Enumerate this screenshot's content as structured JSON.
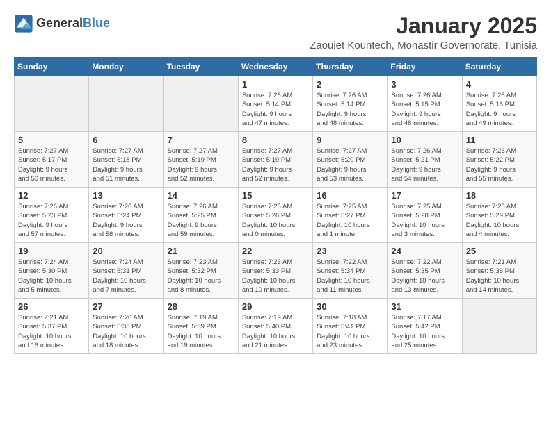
{
  "header": {
    "logo_general": "General",
    "logo_blue": "Blue",
    "title": "January 2025",
    "subtitle": "Zaouiet Kountech, Monastir Governorate, Tunisia"
  },
  "weekdays": [
    "Sunday",
    "Monday",
    "Tuesday",
    "Wednesday",
    "Thursday",
    "Friday",
    "Saturday"
  ],
  "weeks": [
    [
      {
        "day": "",
        "info": ""
      },
      {
        "day": "",
        "info": ""
      },
      {
        "day": "",
        "info": ""
      },
      {
        "day": "1",
        "info": "Sunrise: 7:26 AM\nSunset: 5:14 PM\nDaylight: 9 hours\nand 47 minutes."
      },
      {
        "day": "2",
        "info": "Sunrise: 7:26 AM\nSunset: 5:14 PM\nDaylight: 9 hours\nand 48 minutes."
      },
      {
        "day": "3",
        "info": "Sunrise: 7:26 AM\nSunset: 5:15 PM\nDaylight: 9 hours\nand 48 minutes."
      },
      {
        "day": "4",
        "info": "Sunrise: 7:26 AM\nSunset: 5:16 PM\nDaylight: 9 hours\nand 49 minutes."
      }
    ],
    [
      {
        "day": "5",
        "info": "Sunrise: 7:27 AM\nSunset: 5:17 PM\nDaylight: 9 hours\nand 50 minutes."
      },
      {
        "day": "6",
        "info": "Sunrise: 7:27 AM\nSunset: 5:18 PM\nDaylight: 9 hours\nand 51 minutes."
      },
      {
        "day": "7",
        "info": "Sunrise: 7:27 AM\nSunset: 5:19 PM\nDaylight: 9 hours\nand 52 minutes."
      },
      {
        "day": "8",
        "info": "Sunrise: 7:27 AM\nSunset: 5:19 PM\nDaylight: 9 hours\nand 52 minutes."
      },
      {
        "day": "9",
        "info": "Sunrise: 7:27 AM\nSunset: 5:20 PM\nDaylight: 9 hours\nand 53 minutes."
      },
      {
        "day": "10",
        "info": "Sunrise: 7:26 AM\nSunset: 5:21 PM\nDaylight: 9 hours\nand 54 minutes."
      },
      {
        "day": "11",
        "info": "Sunrise: 7:26 AM\nSunset: 5:22 PM\nDaylight: 9 hours\nand 55 minutes."
      }
    ],
    [
      {
        "day": "12",
        "info": "Sunrise: 7:26 AM\nSunset: 5:23 PM\nDaylight: 9 hours\nand 57 minutes."
      },
      {
        "day": "13",
        "info": "Sunrise: 7:26 AM\nSunset: 5:24 PM\nDaylight: 9 hours\nand 58 minutes."
      },
      {
        "day": "14",
        "info": "Sunrise: 7:26 AM\nSunset: 5:25 PM\nDaylight: 9 hours\nand 59 minutes."
      },
      {
        "day": "15",
        "info": "Sunrise: 7:25 AM\nSunset: 5:26 PM\nDaylight: 10 hours\nand 0 minutes."
      },
      {
        "day": "16",
        "info": "Sunrise: 7:25 AM\nSunset: 5:27 PM\nDaylight: 10 hours\nand 1 minute."
      },
      {
        "day": "17",
        "info": "Sunrise: 7:25 AM\nSunset: 5:28 PM\nDaylight: 10 hours\nand 3 minutes."
      },
      {
        "day": "18",
        "info": "Sunrise: 7:25 AM\nSunset: 5:29 PM\nDaylight: 10 hours\nand 4 minutes."
      }
    ],
    [
      {
        "day": "19",
        "info": "Sunrise: 7:24 AM\nSunset: 5:30 PM\nDaylight: 10 hours\nand 5 minutes."
      },
      {
        "day": "20",
        "info": "Sunrise: 7:24 AM\nSunset: 5:31 PM\nDaylight: 10 hours\nand 7 minutes."
      },
      {
        "day": "21",
        "info": "Sunrise: 7:23 AM\nSunset: 5:32 PM\nDaylight: 10 hours\nand 8 minutes."
      },
      {
        "day": "22",
        "info": "Sunrise: 7:23 AM\nSunset: 5:33 PM\nDaylight: 10 hours\nand 10 minutes."
      },
      {
        "day": "23",
        "info": "Sunrise: 7:22 AM\nSunset: 5:34 PM\nDaylight: 10 hours\nand 11 minutes."
      },
      {
        "day": "24",
        "info": "Sunrise: 7:22 AM\nSunset: 5:35 PM\nDaylight: 10 hours\nand 13 minutes."
      },
      {
        "day": "25",
        "info": "Sunrise: 7:21 AM\nSunset: 5:36 PM\nDaylight: 10 hours\nand 14 minutes."
      }
    ],
    [
      {
        "day": "26",
        "info": "Sunrise: 7:21 AM\nSunset: 5:37 PM\nDaylight: 10 hours\nand 16 minutes."
      },
      {
        "day": "27",
        "info": "Sunrise: 7:20 AM\nSunset: 5:38 PM\nDaylight: 10 hours\nand 18 minutes."
      },
      {
        "day": "28",
        "info": "Sunrise: 7:19 AM\nSunset: 5:39 PM\nDaylight: 10 hours\nand 19 minutes."
      },
      {
        "day": "29",
        "info": "Sunrise: 7:19 AM\nSunset: 5:40 PM\nDaylight: 10 hours\nand 21 minutes."
      },
      {
        "day": "30",
        "info": "Sunrise: 7:18 AM\nSunset: 5:41 PM\nDaylight: 10 hours\nand 23 minutes."
      },
      {
        "day": "31",
        "info": "Sunrise: 7:17 AM\nSunset: 5:42 PM\nDaylight: 10 hours\nand 25 minutes."
      },
      {
        "day": "",
        "info": ""
      }
    ]
  ]
}
